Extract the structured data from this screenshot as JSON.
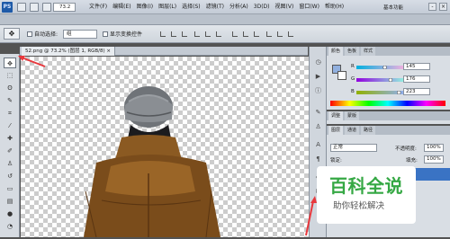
{
  "app": {
    "logo": "PS",
    "zoom": "73.2",
    "workspace": "基本功能"
  },
  "menu": [
    "文件(F)",
    "编辑(E)",
    "图像(I)",
    "图层(L)",
    "选择(S)",
    "滤镜(T)",
    "分析(A)",
    "3D(D)",
    "视图(V)",
    "窗口(W)",
    "帮助(H)"
  ],
  "window_controls": {
    "minimize": "-",
    "close": "×"
  },
  "options": {
    "auto_select_label": "自动选择:",
    "auto_select_value": "组",
    "transform_label": "显示变换控件"
  },
  "document": {
    "tab_title": "52.png @ 73.2% (图层 1, RGB/8) ×"
  },
  "color_panel": {
    "tabs": [
      "颜色",
      "色板",
      "样式"
    ],
    "channels": [
      {
        "label": "R",
        "value": "145",
        "level": 0.57
      },
      {
        "label": "G",
        "value": "176",
        "level": 0.69
      },
      {
        "label": "B",
        "value": "223",
        "level": 0.87
      }
    ],
    "fg_color": "#91b0df",
    "bg_color": "#ffffff"
  },
  "adjust_panel": {
    "tabs": [
      "调整",
      "蒙版"
    ]
  },
  "layers_panel": {
    "tabs": [
      "图层",
      "通道",
      "路径"
    ],
    "blend_mode": "正常",
    "opacity_label": "不透明度:",
    "opacity_value": "100%",
    "lock_label": "锁定:",
    "fill_label": "填充:",
    "fill_value": "100%"
  },
  "watermark": {
    "title": "百科全说",
    "subtitle": "助你轻松解决"
  },
  "colors": {
    "accent": "#3a73c4",
    "watermark_green": "#35a844",
    "arrow_red": "#e8383d"
  }
}
